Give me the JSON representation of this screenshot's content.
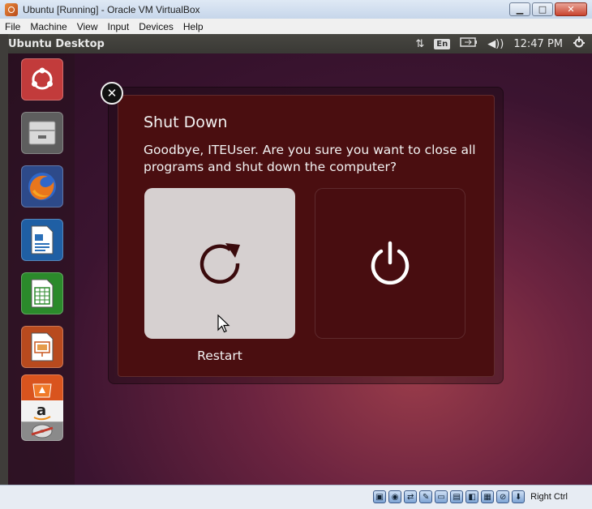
{
  "window": {
    "title": "Ubuntu [Running] - Oracle VM VirtualBox"
  },
  "menu": [
    "File",
    "Machine",
    "View",
    "Input",
    "Devices",
    "Help"
  ],
  "topbar": {
    "title": "Ubuntu Desktop",
    "keyboard": "En",
    "time": "12:47 PM"
  },
  "launcher": {
    "items": [
      "dash-home",
      "files",
      "firefox",
      "libreoffice-writer",
      "libreoffice-calc",
      "libreoffice-impress",
      "ubuntu-software-center",
      "amazon",
      "dvd-drive"
    ]
  },
  "dialog": {
    "title": "Shut Down",
    "message": "Goodbye, ITEUser. Are you sure you want to close all programs and shut down the computer?",
    "restart_label": "Restart"
  },
  "statusbar": {
    "host_key": "Right Ctrl"
  },
  "colors": {
    "dialog_bg": "#4a0e10",
    "selected_option_bg": "#d6d0d0",
    "topbar_bg": "#3a3935",
    "desktop_bg": "#3b1430"
  }
}
